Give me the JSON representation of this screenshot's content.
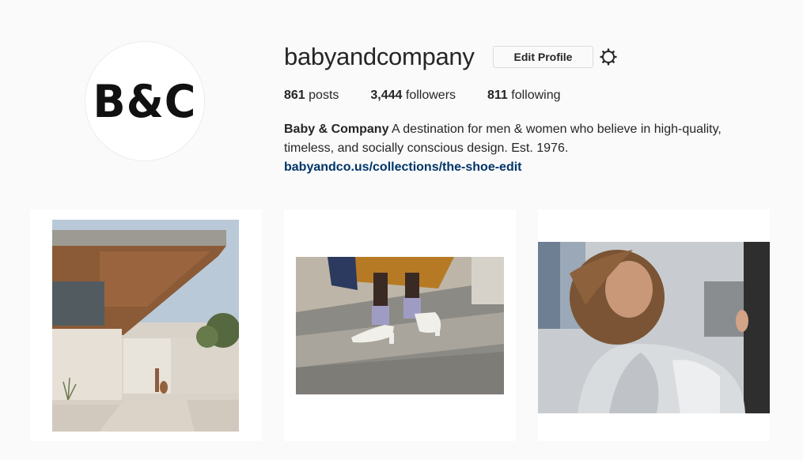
{
  "profile": {
    "avatar_text": "B&C",
    "username": "babyandcompany",
    "edit_profile_label": "Edit Profile",
    "settings_icon": "gear-icon"
  },
  "stats": {
    "posts_count": "861",
    "posts_label": " posts",
    "followers_count": "3,444",
    "followers_label": " followers",
    "following_count": "811",
    "following_label": " following"
  },
  "bio": {
    "name": "Baby & Company",
    "text": " A destination for men & women who believe in high-quality, timeless, and socially conscious design. Est. 1976.",
    "link": "babyandco.us/collections/the-shoe-edit"
  },
  "colors": {
    "link": "#003569",
    "background": "#fafafa",
    "button_border": "#dbdbdb"
  }
}
